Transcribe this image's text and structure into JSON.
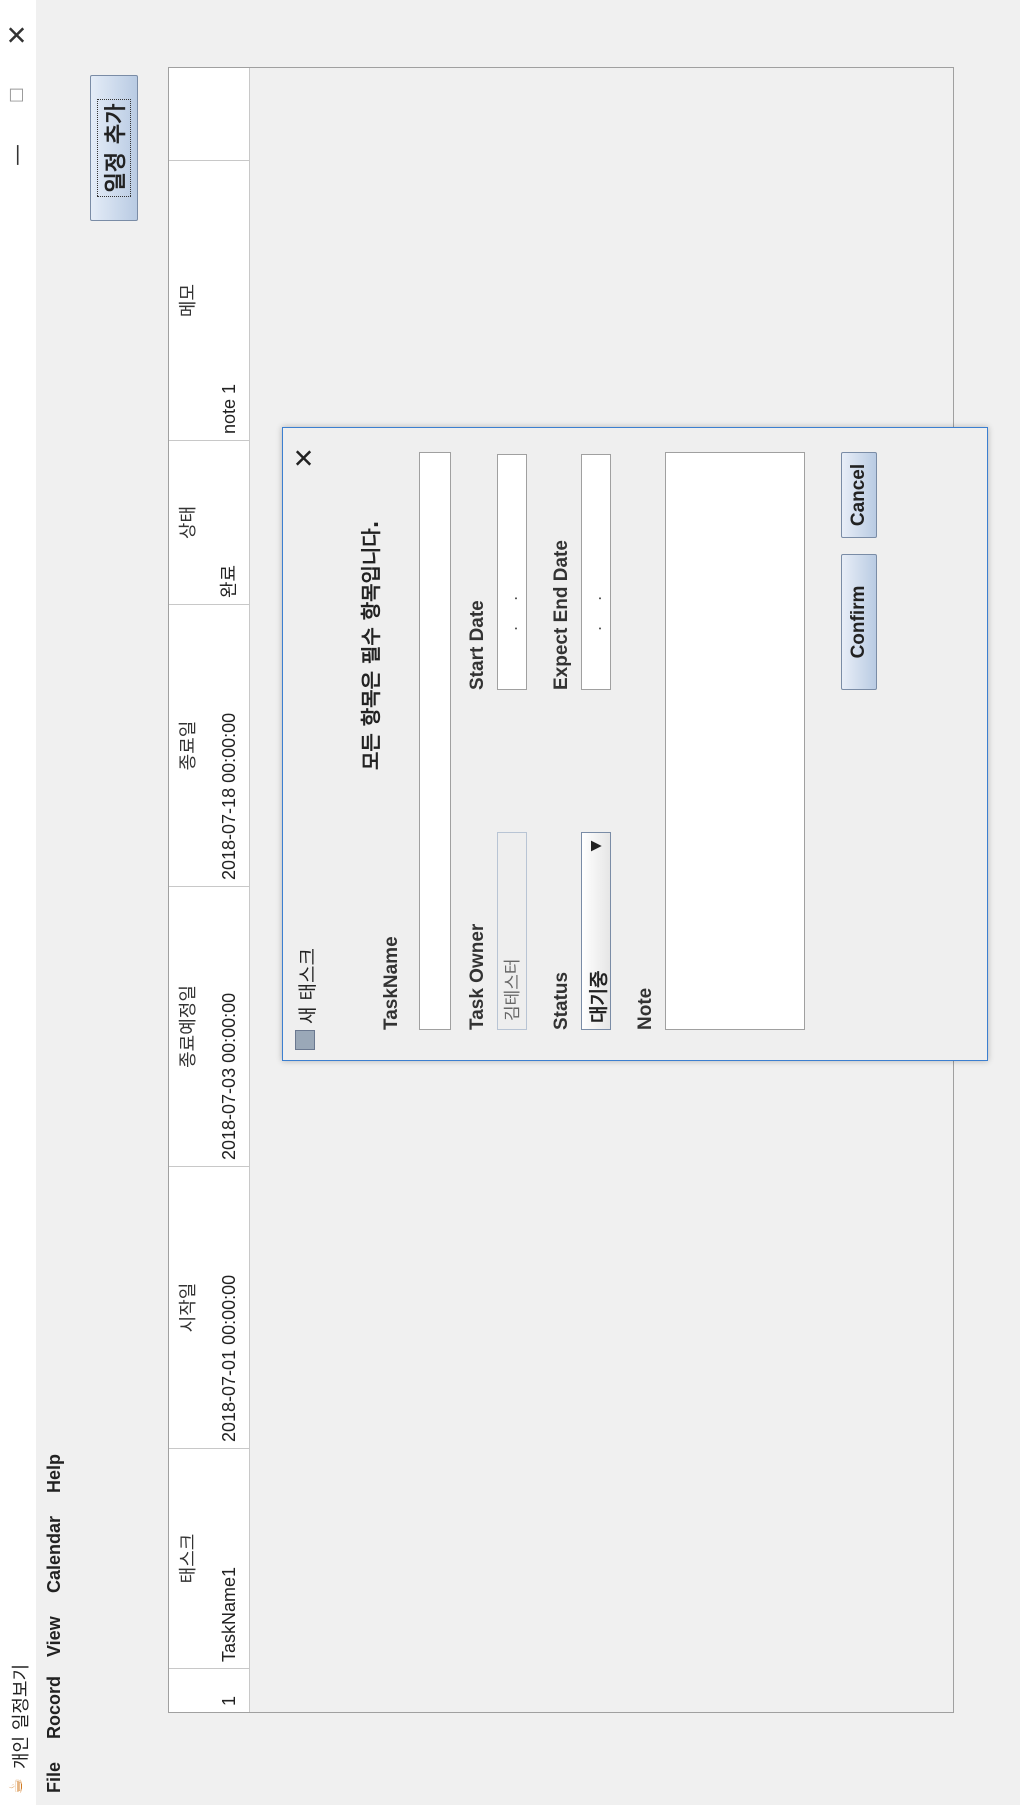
{
  "window": {
    "title": "개인 일정보기",
    "app_icon": "coffee-cup-icon",
    "min_glyph": "—",
    "max_glyph": "☐",
    "close_glyph": "✕"
  },
  "menubar": {
    "items": [
      "File",
      "Rocord",
      "View",
      "Calendar",
      "Help"
    ]
  },
  "toolbar": {
    "add_label": "일정 추가"
  },
  "table": {
    "columns": [
      "",
      "태스크",
      "시작일",
      "종료예정일",
      "종료일",
      "상태",
      "메모"
    ],
    "rows": [
      [
        "1",
        "TaskName1",
        "2018-07-01 00:00:00",
        "2018-07-03 00:00:00",
        "2018-07-18 00:00:00",
        "완료",
        "note 1"
      ]
    ]
  },
  "dialog": {
    "title": "새 태스크",
    "close_glyph": "✕",
    "notice": "모든 항목은 필수 항목입니다.",
    "taskname_label": "TaskName",
    "taskname_value": "",
    "owner_label": "Task Owner",
    "owner_value": "김테스터",
    "start_label": "Start Date",
    "start_value": ". .",
    "status_label": "Status",
    "status_value": "대기중",
    "status_arrow": "▼",
    "expect_label": "Expect End Date",
    "expect_value": ". .",
    "note_label": "Note",
    "note_value": "",
    "confirm_label": "Confirm",
    "cancel_label": "Cancel"
  },
  "colors": {
    "accent_border": "#3c7fd0",
    "button_gradient_bottom": "#b9cbe3",
    "background": "#f0f0f0"
  }
}
